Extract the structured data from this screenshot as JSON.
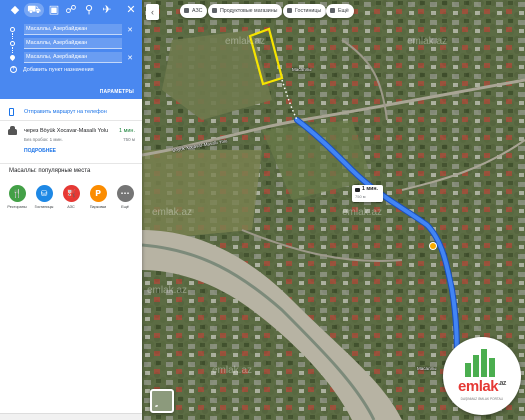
{
  "directions": {
    "modes": [
      "directions-mode",
      "car-mode",
      "transit-mode",
      "walk-mode",
      "bike-mode",
      "flight-mode"
    ],
    "origin": "Масаллы, Азербайджан",
    "waypoint": "Масаллы, Азербайджан",
    "destination": "Масаллы, Азербайджан",
    "add_destination": "Добавить пункт назначения",
    "options_label": "ПАРАМЕТРЫ"
  },
  "send_to_phone": "Отправить маршрут на телефон",
  "route": {
    "via": "через Böyük Xocavar-Masallı Yolu",
    "time": "1 мин.",
    "subtitle": "Без пробок: 1 мин.",
    "distance": "750 м",
    "details": "ПОДРОБНЕЕ"
  },
  "places_title": "Масаллы: популярные места",
  "places": [
    {
      "label": "Рестораны",
      "color": "#43a047",
      "icon": "🍴"
    },
    {
      "label": "Гостиницы",
      "color": "#1e88e5",
      "icon": "⛁"
    },
    {
      "label": "АЗС",
      "color": "#e53935",
      "icon": "⛽"
    },
    {
      "label": "Парковки",
      "color": "#fb8c00",
      "icon": "P"
    },
    {
      "label": "Ещё",
      "color": "#757575",
      "icon": "···"
    }
  ],
  "chips": [
    {
      "label": "АЗС"
    },
    {
      "label": "Продуктовые магазины"
    },
    {
      "label": "Гостиницы"
    },
    {
      "label": "Ещё"
    }
  ],
  "map": {
    "time_bubble_time": "1 мин.",
    "time_bubble_dist": "750 м",
    "watermark": "emlak.az",
    "labels": [
      "Масаллы",
      "Böyük Xocavar-Masallı Yolu",
      "Масаллы"
    ],
    "layers_label": ""
  },
  "logo": {
    "text": "emlak",
    "suffix": ".az",
    "tagline": "DAŞINMAZ ƏMLAK PORTALI"
  },
  "colors": {
    "header_blue": "#4a88f0",
    "route_blue": "#4285f4",
    "plot_outline": "#f5e400"
  }
}
